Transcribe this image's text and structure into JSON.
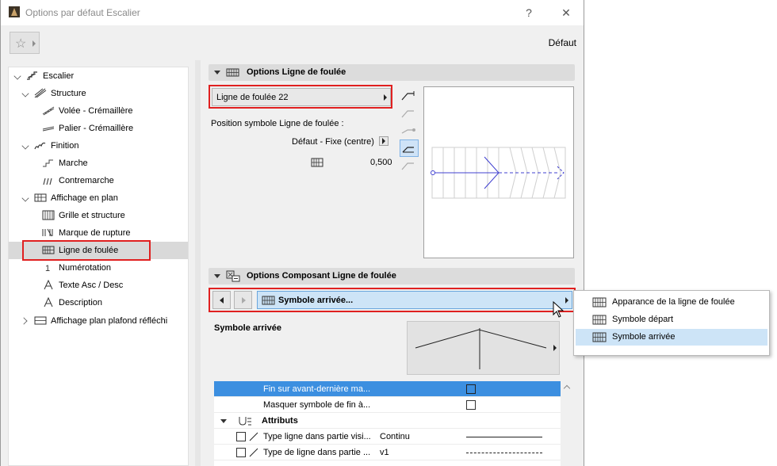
{
  "window": {
    "title": "Options par défaut Escalier",
    "help_label": "?",
    "close_label": "✕"
  },
  "toolbar": {
    "defaut_label": "Défaut"
  },
  "tree": {
    "items": [
      {
        "label": "Escalier"
      },
      {
        "label": "Structure"
      },
      {
        "label": "Volée - Crémaillère"
      },
      {
        "label": "Palier - Crémaillère"
      },
      {
        "label": "Finition"
      },
      {
        "label": "Marche"
      },
      {
        "label": "Contremarche"
      },
      {
        "label": "Affichage en plan"
      },
      {
        "label": "Grille et structure"
      },
      {
        "label": "Marque de rupture"
      },
      {
        "label": "Ligne de foulée"
      },
      {
        "label": "Numérotation"
      },
      {
        "label": "Texte Asc / Desc"
      },
      {
        "label": "Description"
      },
      {
        "label": "Affichage plan plafond réfléchi"
      }
    ],
    "selected_index": 10
  },
  "options_ligne": {
    "header": "Options Ligne de foulée",
    "style_popup": "Ligne de foulée 22",
    "position_label": "Position symbole Ligne de foulée :",
    "position_value": "Défaut - Fixe (centre)",
    "value": "0,500"
  },
  "options_composant": {
    "header": "Options Composant Ligne de foulée",
    "nav_selected": "Symbole arrivée...",
    "symbol_label": "Symbole arrivée"
  },
  "dropdown": {
    "items": [
      {
        "label": "Apparance de la ligne de foulée"
      },
      {
        "label": "Symbole départ"
      },
      {
        "label": "Symbole arrivée"
      }
    ],
    "highlighted_index": 2
  },
  "settings": {
    "rows": [
      {
        "label": "Fin sur avant-dernière ma...",
        "checked": false
      },
      {
        "label": "Masquer symbole de fin à...",
        "checked": false
      }
    ],
    "attributes_header": "Attributs",
    "attributes": [
      {
        "label": "Type ligne dans partie visi...",
        "value": "Continu"
      },
      {
        "label": "Type de ligne dans partie ...",
        "value": "v1"
      }
    ]
  },
  "colors": {
    "accent": "#3c8fe0",
    "highlight": "#cde4f7",
    "red_outline": "#e02020",
    "preview_line": "#4040d0"
  }
}
